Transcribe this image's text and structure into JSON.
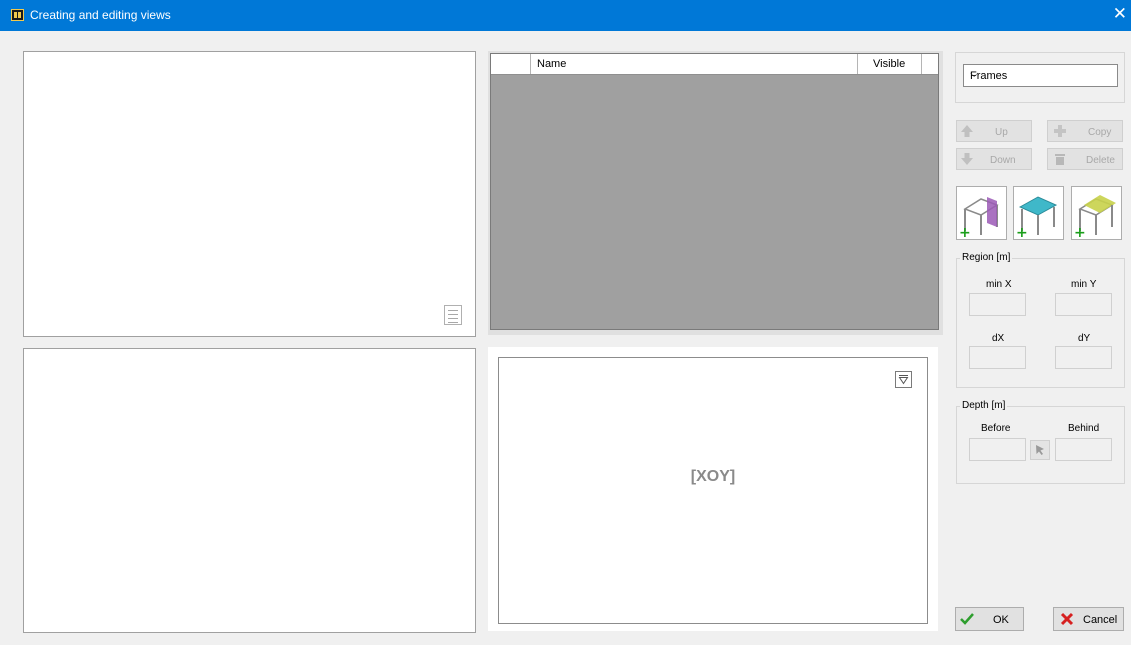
{
  "window": {
    "title": "Creating and editing views",
    "close_glyph": "✕"
  },
  "grid": {
    "columns": [
      "",
      "Name",
      "Visible"
    ]
  },
  "preview": {
    "label": "[XOY]"
  },
  "type_select": {
    "value": "Frames",
    "chevron": "⌵"
  },
  "buttons": {
    "up": "Up",
    "down": "Down",
    "copy": "Copy",
    "delete": "Delete",
    "ok": "OK",
    "cancel": "Cancel"
  },
  "add_view_icons": [
    "add-vertical-plane-view-icon",
    "add-horizontal-plane-view-icon",
    "add-inclined-plane-view-icon"
  ],
  "region": {
    "title": "Region [m]",
    "min_x": "min X",
    "min_y": "min Y",
    "dx": "dX",
    "dy": "dY"
  },
  "depth": {
    "title": "Depth [m]",
    "before": "Before",
    "behind": "Behind"
  },
  "colors": {
    "titlebar": "#0078d7",
    "grid_fill": "#a0a0a0",
    "plane_vertical": "#9b59b6",
    "plane_horizontal": "#3fb8c9",
    "plane_inclined": "#c8d24a",
    "ok_check": "#2e9e2e",
    "cancel_x": "#d62020"
  }
}
